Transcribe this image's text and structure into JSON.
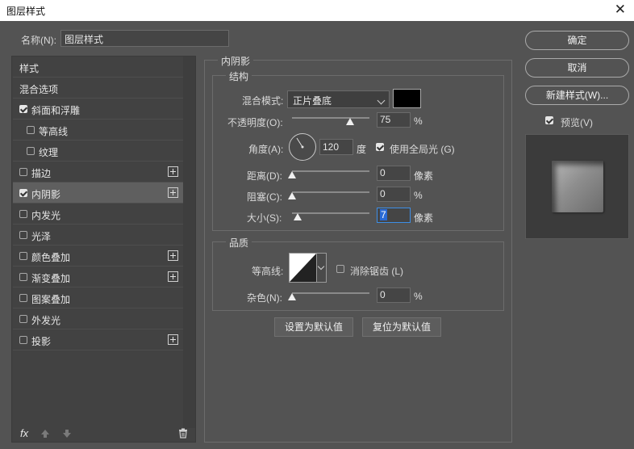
{
  "window": {
    "title": "图层样式",
    "close_glyph": "✕"
  },
  "name_field": {
    "label": "名称(N):",
    "value": "图层样式"
  },
  "style_list": {
    "items": [
      {
        "label": "样式",
        "checkbox": null,
        "plus": false,
        "selected": false,
        "indent": 0
      },
      {
        "label": "混合选项",
        "checkbox": null,
        "plus": false,
        "selected": false,
        "indent": 0
      },
      {
        "label": "斜面和浮雕",
        "checkbox": true,
        "plus": false,
        "selected": false,
        "indent": 0
      },
      {
        "label": "等高线",
        "checkbox": false,
        "plus": false,
        "selected": false,
        "indent": 1
      },
      {
        "label": "纹理",
        "checkbox": false,
        "plus": false,
        "selected": false,
        "indent": 1
      },
      {
        "label": "描边",
        "checkbox": false,
        "plus": true,
        "selected": false,
        "indent": 0
      },
      {
        "label": "内阴影",
        "checkbox": true,
        "plus": true,
        "selected": true,
        "indent": 0
      },
      {
        "label": "内发光",
        "checkbox": false,
        "plus": false,
        "selected": false,
        "indent": 0
      },
      {
        "label": "光泽",
        "checkbox": false,
        "plus": false,
        "selected": false,
        "indent": 0
      },
      {
        "label": "颜色叠加",
        "checkbox": false,
        "plus": true,
        "selected": false,
        "indent": 0
      },
      {
        "label": "渐变叠加",
        "checkbox": false,
        "plus": true,
        "selected": false,
        "indent": 0
      },
      {
        "label": "图案叠加",
        "checkbox": false,
        "plus": false,
        "selected": false,
        "indent": 0
      },
      {
        "label": "外发光",
        "checkbox": false,
        "plus": false,
        "selected": false,
        "indent": 0
      },
      {
        "label": "投影",
        "checkbox": false,
        "plus": true,
        "selected": false,
        "indent": 0
      }
    ],
    "footer": {
      "fx_label": "fx",
      "up_icon": "arrow-up-icon",
      "down_icon": "arrow-down-icon",
      "trash_icon": "trash-icon"
    }
  },
  "inner_shadow": {
    "title": "内阴影",
    "structure": {
      "title": "结构",
      "blend_mode": {
        "label": "混合模式:",
        "value": "正片叠底",
        "color": "#000000"
      },
      "opacity": {
        "label": "不透明度(O):",
        "value": "75",
        "unit": "%"
      },
      "angle": {
        "label": "角度(A):",
        "value": "120",
        "unit": "度",
        "global_light_label": "使用全局光 (G)",
        "global_light": true
      },
      "distance": {
        "label": "距离(D):",
        "value": "0",
        "unit": "像素"
      },
      "choke": {
        "label": "阻塞(C):",
        "value": "0",
        "unit": "%"
      },
      "size": {
        "label": "大小(S):",
        "value": "7",
        "unit": "像素"
      }
    },
    "quality": {
      "title": "品质",
      "contour_label": "等高线:",
      "anti_alias_label": "消除锯齿 (L)",
      "anti_alias": false,
      "noise": {
        "label": "杂色(N):",
        "value": "0",
        "unit": "%"
      }
    },
    "buttons": {
      "set_default": "设置为默认值",
      "reset_default": "复位为默认值"
    }
  },
  "right_panel": {
    "ok": "确定",
    "cancel": "取消",
    "new_style": "新建样式(W)...",
    "preview_label": "预览(V)",
    "preview": true
  }
}
